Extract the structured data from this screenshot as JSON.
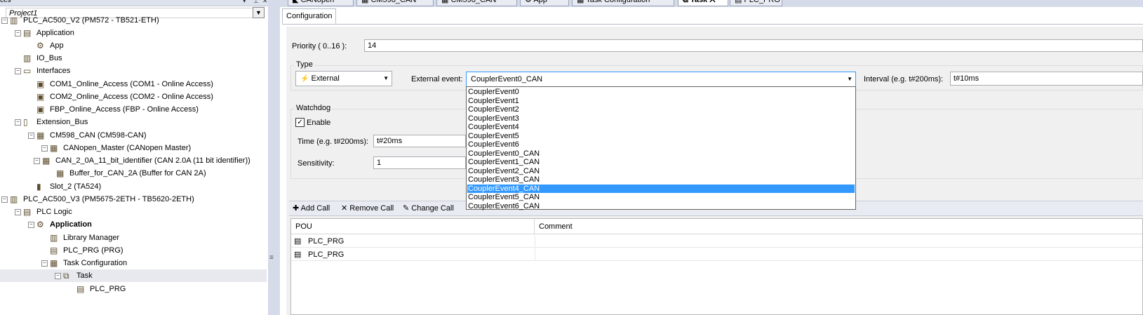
{
  "tree": {
    "header_title": "ces",
    "project": "Project1",
    "items": [
      {
        "label": "PLC_AC500_V2 (PM572 - TB521-ETH)",
        "icon": "plc-icon"
      },
      {
        "label": "Application",
        "icon": "application-icon"
      },
      {
        "label": "App",
        "icon": "gear-icon"
      },
      {
        "label": "IO_Bus",
        "icon": "io-bus-icon"
      },
      {
        "label": "Interfaces",
        "icon": "interfaces-icon"
      },
      {
        "label": "COM1_Online_Access (COM1 - Online Access)",
        "icon": "online-access-icon"
      },
      {
        "label": "COM2_Online_Access (COM2 - Online Access)",
        "icon": "online-access-icon"
      },
      {
        "label": "FBP_Online_Access (FBP - Online Access)",
        "icon": "online-access-icon"
      },
      {
        "label": "Extension_Bus",
        "icon": "extension-bus-icon"
      },
      {
        "label": "CM598_CAN (CM598-CAN)",
        "icon": "module-icon"
      },
      {
        "label": "CANopen_Master (CANopen Master)",
        "icon": "module-icon"
      },
      {
        "label": "CAN_2_0A_11_bit_identifier (CAN 2.0A (11 bit identifier))",
        "icon": "module-icon"
      },
      {
        "label": "Buffer_for_CAN_2A (Buffer for CAN 2A)",
        "icon": "module-icon"
      },
      {
        "label": "Slot_2 (TA524)",
        "icon": "slot-icon"
      },
      {
        "label": "PLC_AC500_V3 (PM5675-2ETH - TB5620-2ETH)",
        "icon": "plc-icon"
      },
      {
        "label": "PLC Logic",
        "icon": "plc-logic-icon"
      },
      {
        "label": "Application",
        "icon": "gear-icon"
      },
      {
        "label": "Library Manager",
        "icon": "library-icon"
      },
      {
        "label": "PLC_PRG (PRG)",
        "icon": "pou-icon"
      },
      {
        "label": "Task Configuration",
        "icon": "task-config-icon"
      },
      {
        "label": "Task",
        "icon": "task-icon"
      },
      {
        "label": "PLC_PRG",
        "icon": "pou-call-icon"
      }
    ]
  },
  "tabs": [
    {
      "label": "CANopen"
    },
    {
      "label": "CM598_CAN"
    },
    {
      "label": "CM598_CAN"
    },
    {
      "label": "App"
    },
    {
      "label": "Task Configuration"
    },
    {
      "label": "Task",
      "active": true
    },
    {
      "label": "PLC_PRG"
    }
  ],
  "config_tab": "Configuration",
  "priority": {
    "label": "Priority ( 0..16 ):",
    "value": "14"
  },
  "type": {
    "group_label": "Type",
    "selected": "External",
    "external_event_label": "External event:",
    "external_event_value": "CouplerEvent0_CAN",
    "interval_label": "Interval (e.g. t#200ms):",
    "interval_value": "t#10ms"
  },
  "event_options": [
    "CouplerEvent0",
    "CouplerEvent1",
    "CouplerEvent2",
    "CouplerEvent3",
    "CouplerEvent4",
    "CouplerEvent5",
    "CouplerEvent6",
    "CouplerEvent0_CAN",
    "CouplerEvent1_CAN",
    "CouplerEvent2_CAN",
    "CouplerEvent3_CAN",
    "CouplerEvent4_CAN",
    "CouplerEvent5_CAN",
    "CouplerEvent6_CAN"
  ],
  "event_highlighted": 11,
  "watchdog": {
    "group_label": "Watchdog",
    "enable_label": "Enable",
    "enabled": true,
    "time_label": "Time (e.g. t#200ms):",
    "time_value": "t#20ms",
    "sensitivity_label": "Sensitivity:",
    "sensitivity_value": "1"
  },
  "toolbar": {
    "add_call": "Add Call",
    "remove_call": "Remove Call",
    "change_call": "Change Call"
  },
  "grid": {
    "headers": [
      "POU",
      "Comment"
    ],
    "rows": [
      [
        "PLC_PRG",
        ""
      ],
      [
        "PLC_PRG",
        ""
      ]
    ]
  },
  "colors": {
    "selection": "#3399ff",
    "tree_bg": "#ffffff",
    "chrome": "#d6dbe9"
  }
}
